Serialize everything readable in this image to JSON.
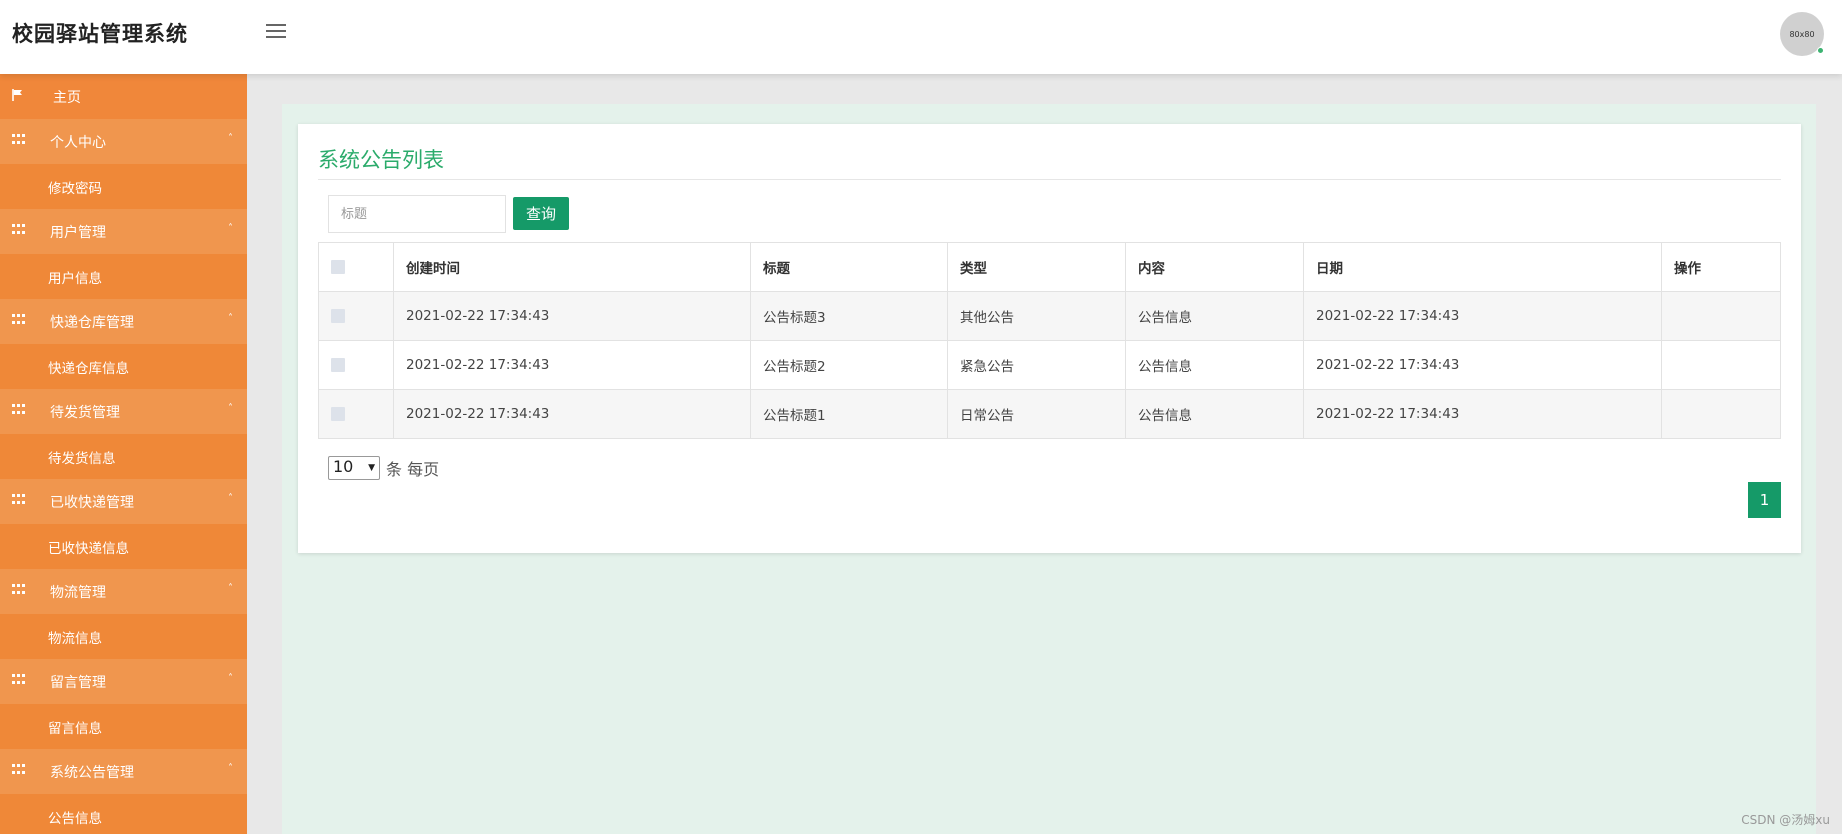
{
  "header": {
    "app_title": "校园驿站管理系统",
    "avatar_text": "80x80"
  },
  "sidebar": {
    "items": [
      {
        "label": "主页",
        "kind": "home",
        "icon": "flag-icon"
      },
      {
        "label": "个人中心",
        "kind": "head",
        "icon": "grid-icon"
      },
      {
        "label": "修改密码",
        "kind": "sub"
      },
      {
        "label": "用户管理",
        "kind": "head",
        "icon": "grid-icon"
      },
      {
        "label": "用户信息",
        "kind": "sub"
      },
      {
        "label": "快递仓库管理",
        "kind": "head",
        "icon": "grid-icon"
      },
      {
        "label": "快递仓库信息",
        "kind": "sub"
      },
      {
        "label": "待发货管理",
        "kind": "head",
        "icon": "grid-icon"
      },
      {
        "label": "待发货信息",
        "kind": "sub"
      },
      {
        "label": "已收快递管理",
        "kind": "head",
        "icon": "grid-icon"
      },
      {
        "label": "已收快递信息",
        "kind": "sub"
      },
      {
        "label": "物流管理",
        "kind": "head",
        "icon": "grid-icon"
      },
      {
        "label": "物流信息",
        "kind": "sub"
      },
      {
        "label": "留言管理",
        "kind": "head",
        "icon": "grid-icon"
      },
      {
        "label": "留言信息",
        "kind": "sub"
      },
      {
        "label": "系统公告管理",
        "kind": "head",
        "icon": "grid-icon"
      },
      {
        "label": "公告信息",
        "kind": "sub"
      }
    ],
    "caret": "˄"
  },
  "main": {
    "title": "系统公告列表",
    "search": {
      "placeholder": "标题",
      "button_label": "查询"
    },
    "table": {
      "columns": [
        "创建时间",
        "标题",
        "类型",
        "内容",
        "日期",
        "操作"
      ],
      "rows": [
        {
          "created": "2021-02-22 17:34:43",
          "title": "公告标题3",
          "type": "其他公告",
          "content": "公告信息",
          "date": "2021-02-22 17:34:43",
          "action": ""
        },
        {
          "created": "2021-02-22 17:34:43",
          "title": "公告标题2",
          "type": "紧急公告",
          "content": "公告信息",
          "date": "2021-02-22 17:34:43",
          "action": ""
        },
        {
          "created": "2021-02-22 17:34:43",
          "title": "公告标题1",
          "type": "日常公告",
          "content": "公告信息",
          "date": "2021-02-22 17:34:43",
          "action": ""
        }
      ]
    },
    "pagination": {
      "page_size": "10",
      "page_size_suffix": "条 每页",
      "current_page": "1"
    }
  },
  "watermark": "CSDN @汤姆xu",
  "colors": {
    "sidebar": "#f08b3c",
    "accent_green": "#159a68",
    "title_green": "#2bab6b"
  }
}
